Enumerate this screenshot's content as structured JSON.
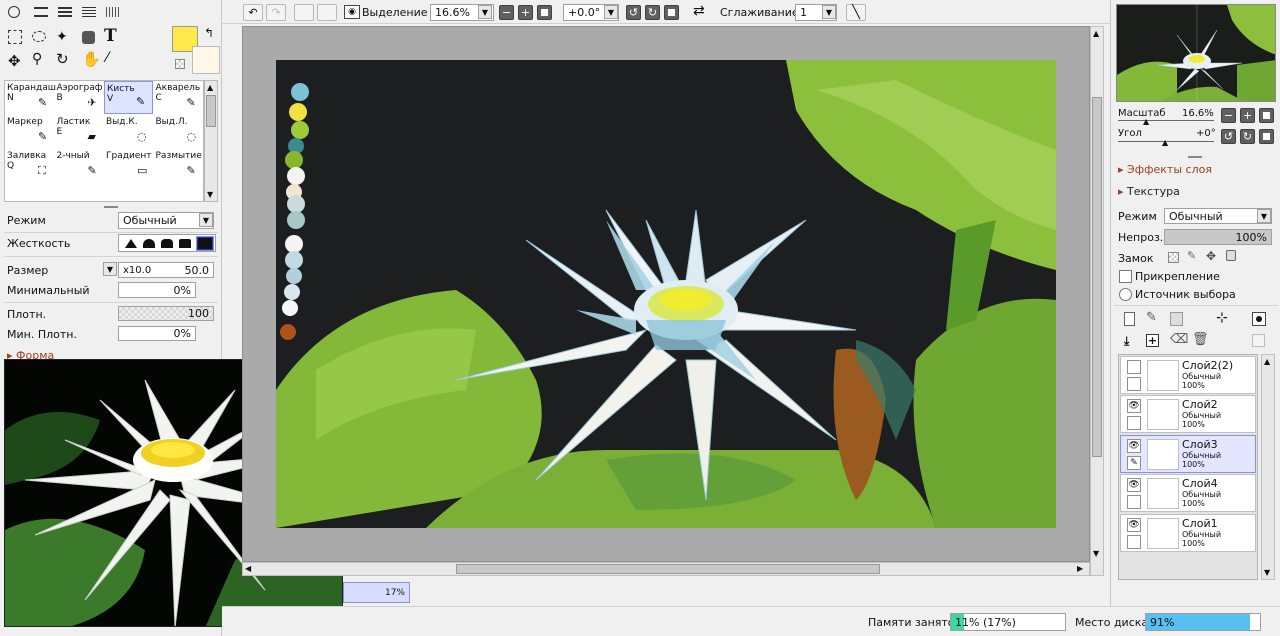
{
  "toolbar": {
    "selection_label": "Выделение",
    "zoom_value": "16.6%",
    "angle_value": "+0.0°",
    "smoothing_label": "Сглаживание",
    "smoothing_value": "1"
  },
  "colors": {
    "primary": "#ffe84a",
    "secondary": "#fdf8e8"
  },
  "brush_tools": [
    {
      "label": "Карандаш",
      "key": "N"
    },
    {
      "label": "Аэрограф",
      "key": "B"
    },
    {
      "label": "Кисть",
      "key": "V"
    },
    {
      "label": "Акварель",
      "key": "C"
    },
    {
      "label": "Маркер",
      "key": ""
    },
    {
      "label": "Ластик",
      "key": "E"
    },
    {
      "label": "Выд.К.",
      "key": ""
    },
    {
      "label": "Выд.Л.",
      "key": ""
    },
    {
      "label": "Заливка",
      "key": "Q"
    },
    {
      "label": "2-чный",
      "key": ""
    },
    {
      "label": "Градиент",
      "key": ""
    },
    {
      "label": "Размытие",
      "key": ""
    }
  ],
  "brush_settings": {
    "mode_label": "Режим",
    "mode_value": "Обычный",
    "hardness_label": "Жесткость",
    "size_label": "Размер",
    "size_multiplier": "x10.0",
    "size_value": "50.0",
    "min_size_label": "Минимальный",
    "min_size_value": "0%",
    "density_label": "Плотн.",
    "density_value": "100",
    "min_density_label": "Мин. Плотн.",
    "min_density_value": "0%",
    "shape_label": "Форма"
  },
  "canvas_tab": {
    "percent": "17%"
  },
  "navigator": {
    "scale_label": "Масштаб",
    "scale_value": "16.6%",
    "angle_label": "Угол",
    "angle_value": "+0°"
  },
  "layer_panel": {
    "effects_label": "Эффекты слоя",
    "texture_label": "Текстура",
    "mode_label": "Режим",
    "mode_value": "Обычный",
    "opacity_label": "Непроз.",
    "opacity_value": "100%",
    "lock_label": "Замок",
    "clipping_label": "Прикрепление",
    "source_label": "Источник выбора"
  },
  "layers": [
    {
      "name": "Слой2(2)",
      "mode": "Обычный",
      "opacity": "100%",
      "visible": false,
      "selected": false
    },
    {
      "name": "Слой2",
      "mode": "Обычный",
      "opacity": "100%",
      "visible": true,
      "selected": false
    },
    {
      "name": "Слой3",
      "mode": "Обычный",
      "opacity": "100%",
      "visible": true,
      "selected": true
    },
    {
      "name": "Слой4",
      "mode": "Обычный",
      "opacity": "100%",
      "visible": true,
      "selected": false
    },
    {
      "name": "Слой1",
      "mode": "Обычный",
      "opacity": "100%",
      "visible": true,
      "selected": false
    }
  ],
  "status": {
    "memory_label": "Памяти занято",
    "memory_value": "11% (17%)",
    "memory_fraction": 0.11,
    "disk_label": "Место диска",
    "disk_value": "91%",
    "disk_fraction": 0.91
  }
}
